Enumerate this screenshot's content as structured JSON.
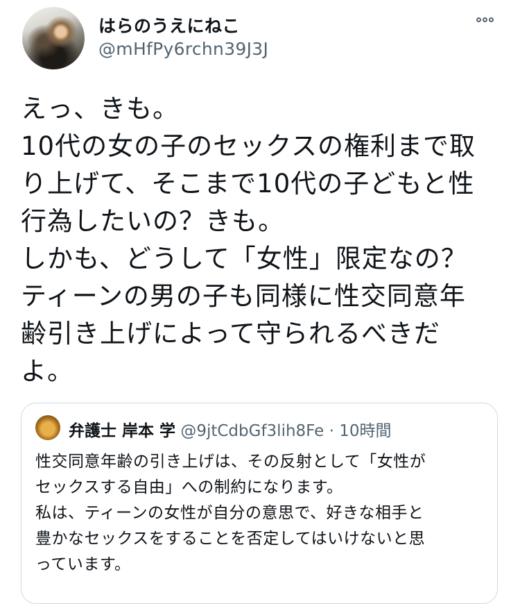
{
  "author": {
    "display_name": "はらのうえにねこ",
    "handle": "@mHfPy6rchn39J3J"
  },
  "tweet": {
    "text": "えっ、きも。\n10代の女の子のセックスの権利まで取\nり上げて、そこまで10代の子どもと性\n行為したいの？きも。\nしかも、どうして「女性」限定なの？\nティーンの男の子も同様に性交同意年\n齢引き上げによって守られるべきだ\nよ。"
  },
  "icons": {
    "more": "more-horizontal-icon"
  },
  "quoted_tweet": {
    "display_name": "弁護士 岸本 学",
    "handle": "@9jtCdbGf3lih8Fe",
    "separator": "·",
    "time": "10時間",
    "text": "性交同意年齢の引き上げは、その反射として「女性が\nセックスする自由」への制約になります。\n私は、ティーンの女性が自分の意思で、好きな相手と\n豊かなセックスをすることを否定してはいけないと思\nっています。"
  }
}
